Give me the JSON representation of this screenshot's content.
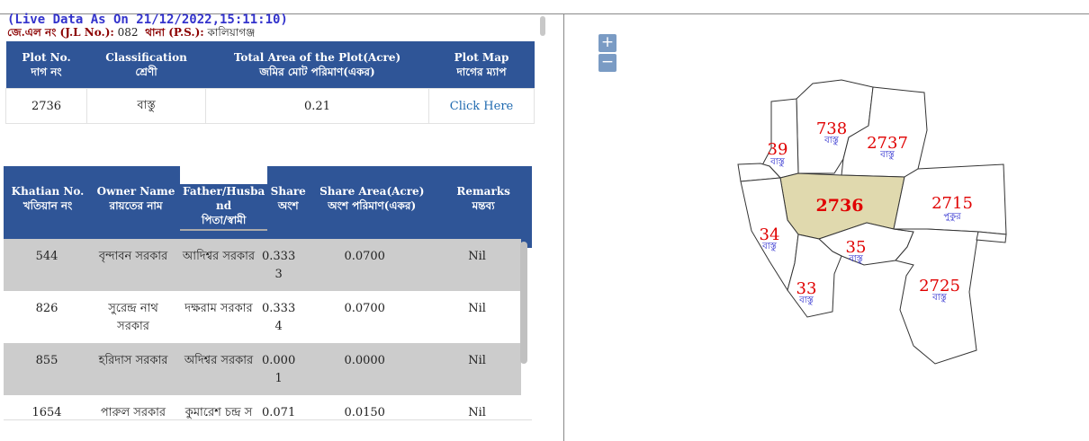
{
  "header": {
    "live_text": "(Live Data As On 21/12/2022,15:11:10)",
    "jl_label": "জে.এল নং (J.L No.):",
    "jl_value": "082",
    "ps_label": "থানা (P.S.):",
    "ps_value": "কালিয়াগঞ্জ"
  },
  "plot_table": {
    "headers": [
      {
        "en": "Plot No.",
        "bn": "দাগ নং"
      },
      {
        "en": "Classification",
        "bn": "শ্রেণী"
      },
      {
        "en": "Total Area of the Plot(Acre)",
        "bn": "জমির মোট পরিমাণ(একর)"
      },
      {
        "en": "Plot Map",
        "bn": "দাগের ম্যাপ"
      }
    ],
    "row": {
      "plot_no": "2736",
      "classification": "বাস্তু",
      "area": "0.21",
      "map_link": "Click Here"
    }
  },
  "owner_table": {
    "headers": [
      {
        "en": "Khatian No.",
        "bn": "খতিয়ান নং"
      },
      {
        "en": "Owner Name",
        "bn": "রায়তের নাম"
      },
      {
        "en": "Father/Husba nd",
        "bn": "পিতা/স্বামী"
      },
      {
        "en": "Share",
        "bn": "অংশ"
      },
      {
        "en": "Share Area(Acre)",
        "bn": "অংশ পরিমাণ(একর)"
      },
      {
        "en": "Remarks",
        "bn": "মন্তব্য"
      }
    ],
    "rows": [
      {
        "khatian": "544",
        "owner": "বৃন্দাবন সরকার",
        "father": "আদিশ্বর সরকার",
        "share": "0.3333",
        "share_area": "0.0700",
        "remarks": "Nil"
      },
      {
        "khatian": "826",
        "owner": "সুরেন্দ্র নাথ সরকার",
        "father": "দক্ষরাম সরকার",
        "share": "0.3334",
        "share_area": "0.0700",
        "remarks": "Nil"
      },
      {
        "khatian": "855",
        "owner": "হরিদাস সরকার",
        "father": "অদিশ্বর সরকার",
        "share": "0.0001",
        "share_area": "0.0000",
        "remarks": "Nil"
      },
      {
        "khatian": "1654",
        "owner": "পারুল সরকার",
        "father": "কুমারেশ চন্দ্র স",
        "share": "0.071",
        "share_area": "0.0150",
        "remarks": "Nil"
      }
    ]
  },
  "map": {
    "zoom_in": "+",
    "zoom_out": "−",
    "selected_fill": "#e0d9ae",
    "plots": [
      {
        "num": "738",
        "cls": "বাস্তু"
      },
      {
        "num": "2737",
        "cls": "বাস্তু"
      },
      {
        "num": "39",
        "cls": "বাস্তু"
      },
      {
        "num": "2736",
        "cls": ""
      },
      {
        "num": "2715",
        "cls": "পুকুর"
      },
      {
        "num": "34",
        "cls": "বাস্তু"
      },
      {
        "num": "35",
        "cls": "বাস্তু"
      },
      {
        "num": "33",
        "cls": "বাস্তু"
      },
      {
        "num": "2725",
        "cls": "বাস্তু"
      }
    ]
  }
}
